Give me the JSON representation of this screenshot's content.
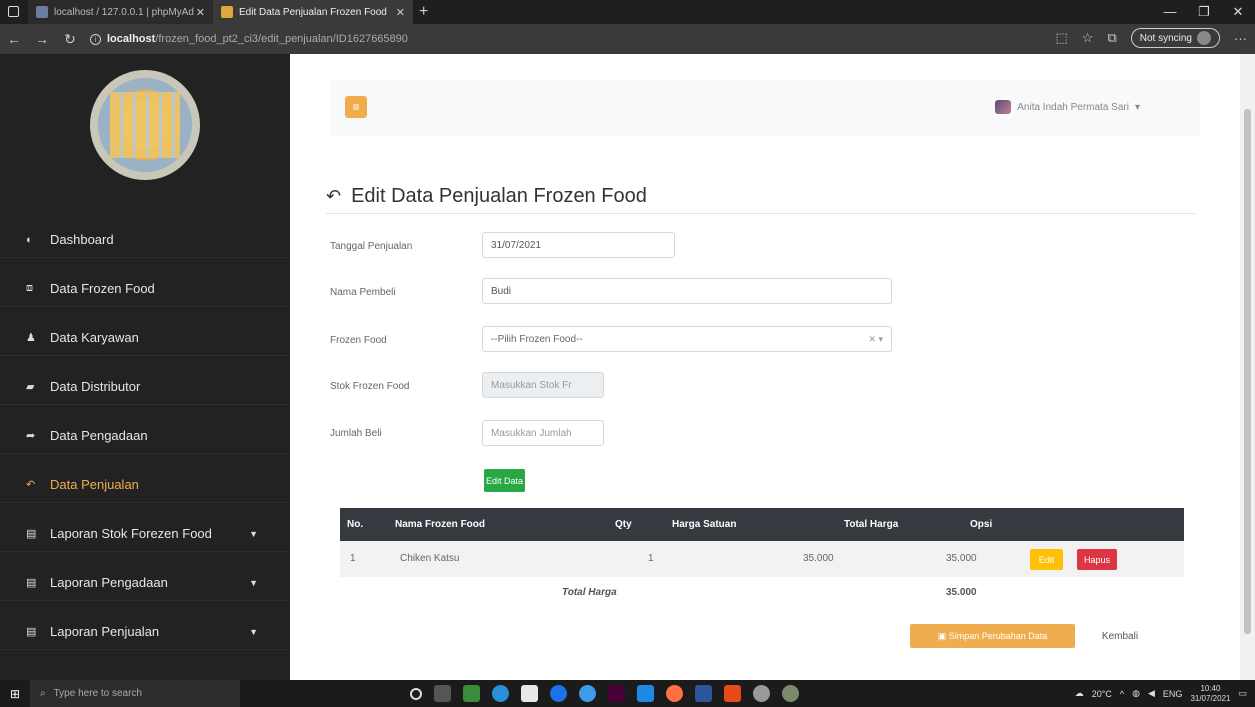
{
  "browser": {
    "tabs": [
      {
        "label": "localhost / 127.0.0.1 | phpMyAd",
        "active": false
      },
      {
        "label": "Edit Data Penjualan Frozen Food",
        "active": true
      }
    ],
    "url_host": "localhost",
    "url_path": "/frozen_food_pt2_ci3/edit_penjualan/ID1627665890",
    "sync_label": "Not syncing"
  },
  "sidebar": {
    "items": [
      {
        "label": "Dashboard",
        "icon": "tachometer-icon"
      },
      {
        "label": "Data Frozen Food",
        "icon": "boxes-icon"
      },
      {
        "label": "Data Karyawan",
        "icon": "users-icon"
      },
      {
        "label": "Data Distributor",
        "icon": "truck-icon"
      },
      {
        "label": "Data Pengadaan",
        "icon": "share-icon"
      },
      {
        "label": "Data Penjualan",
        "icon": "reply-icon",
        "active": true
      },
      {
        "label": "Laporan Stok Forezen Food",
        "icon": "file-icon"
      },
      {
        "label": "Laporan Pengadaan",
        "icon": "file-icon"
      },
      {
        "label": "Laporan Penjualan",
        "icon": "file-icon"
      }
    ]
  },
  "header": {
    "user_name": "Anita Indah Permata Sari"
  },
  "page": {
    "title": "Edit Data Penjualan Frozen Food"
  },
  "form": {
    "tanggal_label": "Tanggal Penjualan",
    "tanggal_value": "31/07/2021",
    "nama_label": "Nama Pembeli",
    "nama_value": "Budi",
    "frozen_label": "Frozen Food",
    "frozen_value": "--Pilih Frozen Food--",
    "stok_label": "Stok Frozen Food",
    "stok_placeholder": "Masukkan Stok Fr",
    "jumlah_label": "Jumlah Beli",
    "jumlah_placeholder": "Masukkan Jumlah",
    "submit_label": "Edit Data"
  },
  "table": {
    "headers": [
      "No.",
      "Nama Frozen Food",
      "Qty",
      "Harga Satuan",
      "Total Harga",
      "Opsi"
    ],
    "rows": [
      {
        "no": "1",
        "nama": "Chiken Katsu",
        "qty": "1",
        "harga": "35.000",
        "total": "35.000"
      }
    ],
    "edit_label": "Edit",
    "hapus_label": "Hapus",
    "footer_label": "Total Harga",
    "footer_total": "35.000"
  },
  "actions": {
    "save_label": "Simpan Perubahan Data",
    "back_label": "Kembali"
  },
  "taskbar": {
    "search_placeholder": "Type here to search",
    "weather": "20°C",
    "lang": "ENG",
    "time": "10:40",
    "date": "31/07/2021"
  },
  "colors": {
    "accent": "#f0ad4e",
    "success": "#28a745",
    "danger": "#dc3545",
    "warning": "#ffc107",
    "sidebar_bg": "#222222"
  }
}
